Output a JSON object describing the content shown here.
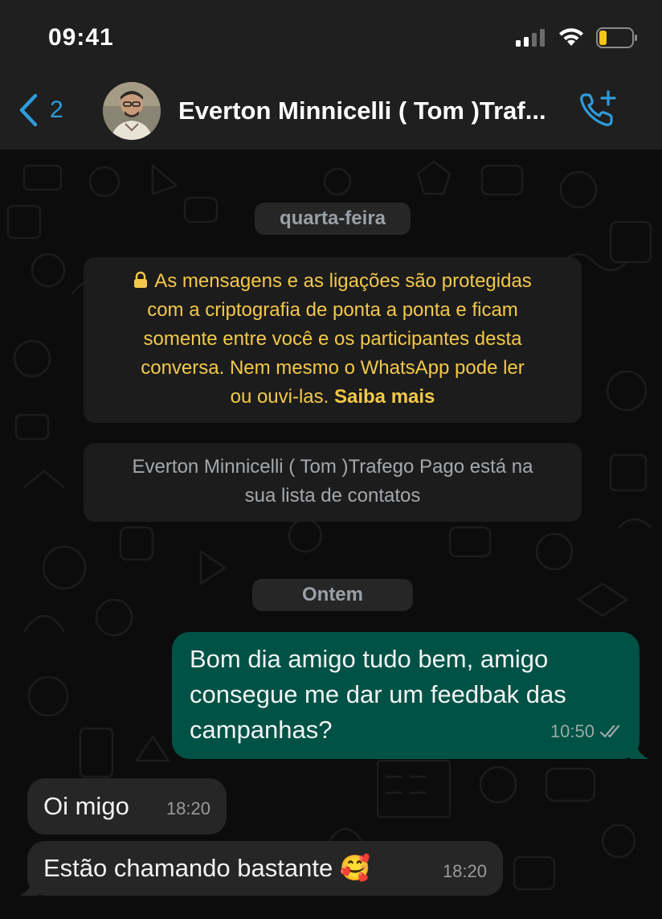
{
  "status_bar": {
    "time": "09:41",
    "icons": [
      "signal-icon",
      "wifi-icon",
      "battery-icon"
    ]
  },
  "header": {
    "back_count": "2",
    "contact_name": "Everton Minnicelli ( Tom )Traf...",
    "icons": [
      "chevron-left-icon",
      "avatar",
      "add-call-icon"
    ]
  },
  "chat": {
    "date_wednesday": "quarta-feira",
    "encryption_notice": {
      "line1": "As mensagens e as ligações são protegidas",
      "line2": "com a criptografia de ponta a ponta e ficam",
      "line3": "somente entre você e os participantes desta",
      "line4": "conversa. Nem mesmo o WhatsApp pode ler",
      "line5_text": "ou ouvi-las.",
      "learn_more": "Saiba mais",
      "icon": "lock-icon"
    },
    "contact_notice": {
      "line1": "Everton Minnicelli ( Tom )Trafego Pago está na",
      "line2": "sua lista de contatos"
    },
    "date_yesterday": "Ontem",
    "messages": [
      {
        "direction": "outgoing",
        "lines": [
          "Bom dia amigo tudo bem, amigo",
          "consegue me dar um feedbak das",
          "campanhas?"
        ],
        "time": "10:50",
        "status_icon": "double-check-icon"
      },
      {
        "direction": "incoming",
        "text": "Oi migo",
        "time": "18:20"
      },
      {
        "direction": "incoming",
        "text": "Estão chamando bastante 🥰",
        "time": "18:20"
      }
    ]
  },
  "colors": {
    "header_bg": "#1f1f1f",
    "accent_blue": "#2d9cdb",
    "outgoing_bubble": "#005246",
    "incoming_bubble": "#262626",
    "notice_yellow": "#f3c84a",
    "battery_yellow": "#f5c518"
  }
}
